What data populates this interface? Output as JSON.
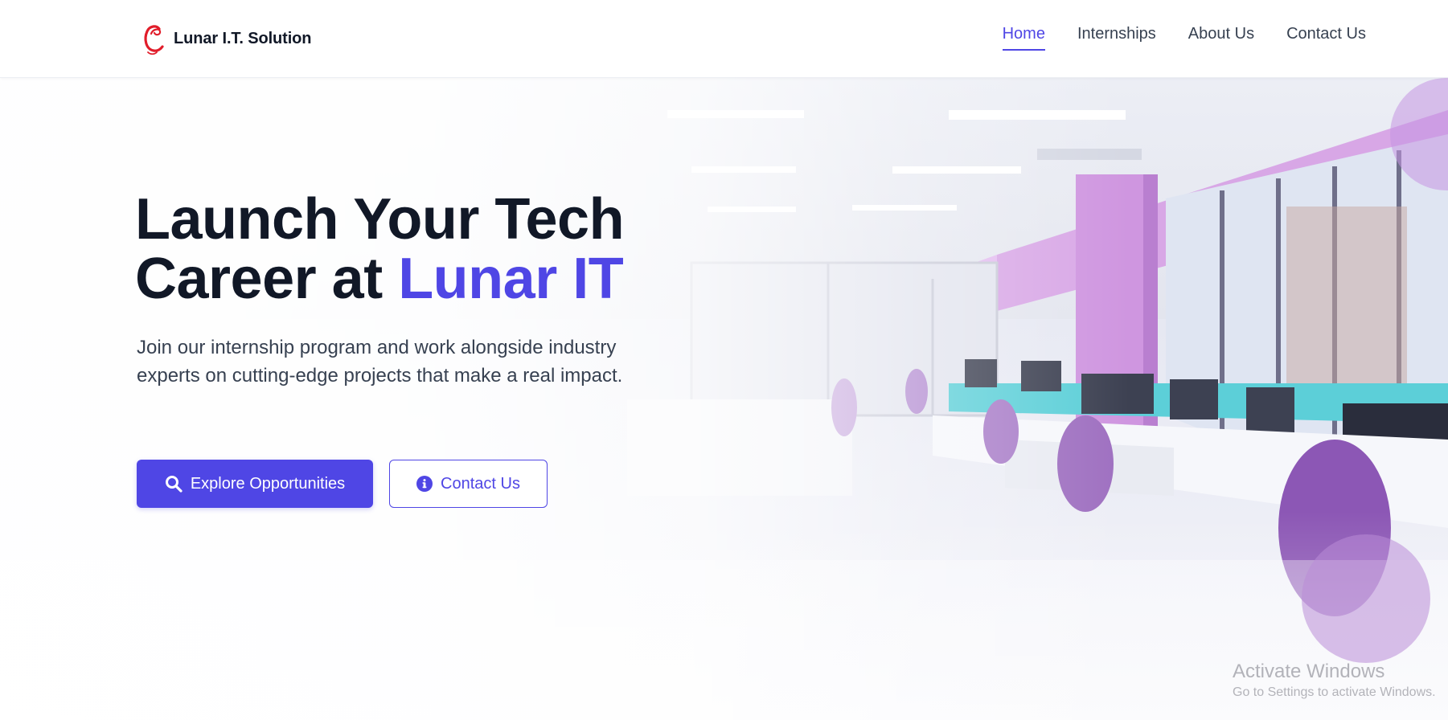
{
  "brand": {
    "name": "Lunar I.T. Solution",
    "logo_icon": "swirl-c-logo",
    "logo_color": "#e11d2a"
  },
  "nav": {
    "items": [
      {
        "label": "Home",
        "active": true
      },
      {
        "label": "Internships",
        "active": false
      },
      {
        "label": "About Us",
        "active": false
      },
      {
        "label": "Contact Us",
        "active": false
      }
    ]
  },
  "hero": {
    "title_line1": "Launch Your Tech",
    "title_line2_prefix": "Career at ",
    "title_line2_accent": "Lunar IT",
    "subtitle": "Join our internship program and work alongside industry experts on cutting-edge projects that make a real impact.",
    "background": "office-interior-photo",
    "primary_button": {
      "label": "Explore Opportunities",
      "icon": "search-icon"
    },
    "secondary_button": {
      "label": "Contact Us",
      "icon": "info-circle-icon"
    }
  },
  "watermark": {
    "title": "Activate Windows",
    "subtitle": "Go to Settings to activate Windows."
  },
  "colors": {
    "accent": "#4f46e5",
    "heading": "#111827",
    "body_text": "#374151",
    "header_bg": "#ffffff"
  }
}
